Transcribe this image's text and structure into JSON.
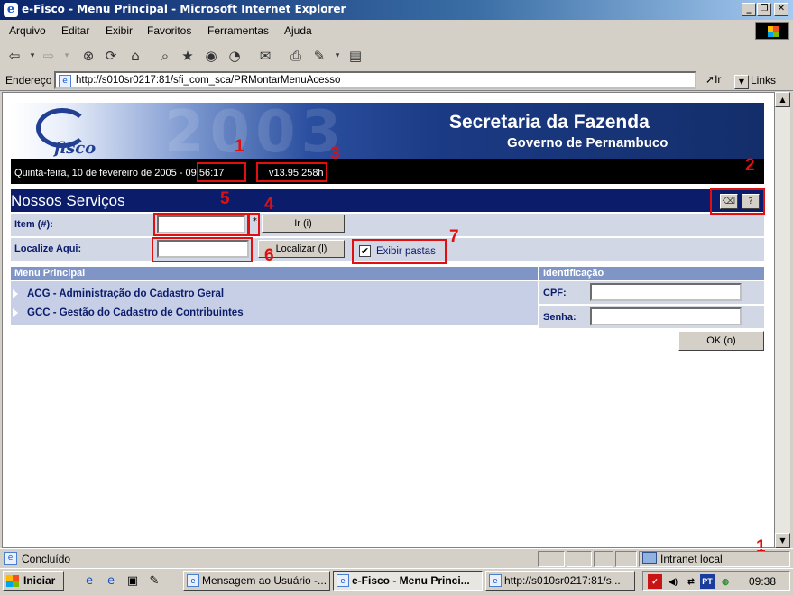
{
  "window": {
    "title": "e-Fisco - Menu Principal - Microsoft Internet Explorer",
    "min_glyph": "_",
    "max_glyph": "❐",
    "close_glyph": "✕"
  },
  "menu": [
    "Arquivo",
    "Editar",
    "Exibir",
    "Favoritos",
    "Ferramentas",
    "Ajuda"
  ],
  "address": {
    "label": "Endereço",
    "url": "http://s010sr0217:81/sfi_com_sca/PRMontarMenuAcesso",
    "go_label": "Ir",
    "links_label": "Links"
  },
  "banner": {
    "logo_text": "fisco",
    "year": "2003",
    "org_title": "Secretaria da Fazenda",
    "org_subtitle": "Governo de Pernambuco"
  },
  "datebar": {
    "date_text": "Quinta-feira, 10 de fevereiro de 2005 - 09:56:17",
    "version": "v13.95.258h"
  },
  "services": {
    "title": "Nossos Serviços",
    "item_label": "Item (#):",
    "item_required_mark": "*",
    "go_button": "Ir (i)",
    "find_label": "Localize Aqui:",
    "find_button": "Localizar (l)",
    "show_folders_label": "Exibir pastas",
    "show_folders_checked": true
  },
  "main_menu": {
    "header": "Menu Principal",
    "items": [
      "ACG - Administração do Cadastro Geral",
      "GCC - Gestão do Cadastro de Contribuintes"
    ]
  },
  "identification": {
    "header": "Identificação",
    "cpf_label": "CPF:",
    "password_label": "Senha:",
    "ok_button": "OK (o)"
  },
  "annotations": [
    "1",
    "2",
    "3",
    "4",
    "5",
    "6",
    "7",
    "1"
  ],
  "statusbar": {
    "status": "Concluído",
    "zone": "Intranet local"
  },
  "taskbar": {
    "start": "Iniciar",
    "tasks": [
      "Mensagem ao Usuário -...",
      "e-Fisco - Menu Princi...",
      "http://s010sr0217:81/s..."
    ],
    "clock": "09:38",
    "tray_lang": "PT"
  },
  "colors": {
    "annotation": "#e01010",
    "navy_header": "#0b1c6b",
    "row_bg": "#d2d7e6"
  }
}
